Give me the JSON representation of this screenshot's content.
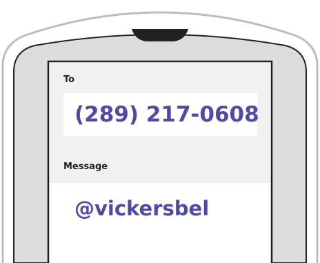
{
  "compose": {
    "to_label": "To",
    "phone_number": "(289) 217-0608",
    "message_label": "Message",
    "message_text": "@vickersbel"
  },
  "colors": {
    "accent_text": "#4f4aa5",
    "panel_bg": "#f1f1f1",
    "bezel": "#dcdcdc",
    "outline": "#222222"
  },
  "icons": {
    "earpiece": "earpiece-speaker-icon"
  }
}
